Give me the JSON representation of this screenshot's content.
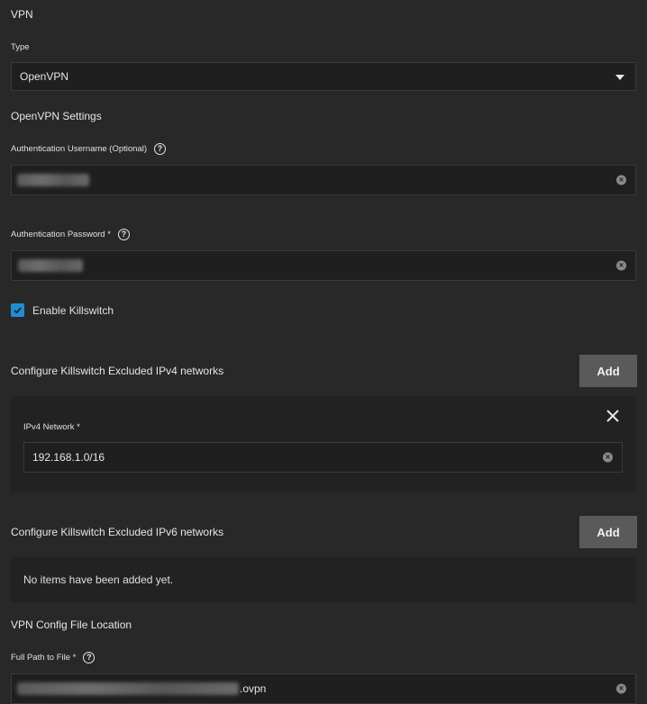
{
  "vpn": {
    "section_title": "VPN",
    "type_label": "Type",
    "type_value": "OpenVPN"
  },
  "openvpn": {
    "section_title": "OpenVPN Settings",
    "username_label": "Authentication Username (Optional)",
    "password_label": "Authentication Password *",
    "killswitch_label": "Enable Killswitch",
    "killswitch_checked": true
  },
  "ipv4": {
    "title": "Configure Killswitch Excluded IPv4 networks",
    "add_label": "Add",
    "network_label": "IPv4 Network *",
    "network_value": "192.168.1.0/16"
  },
  "ipv6": {
    "title": "Configure Killswitch Excluded IPv6 networks",
    "add_label": "Add",
    "empty_text": "No items have been added yet."
  },
  "config": {
    "section_title": "VPN Config File Location",
    "path_label": "Full Path to File *",
    "path_suffix": ".ovpn"
  },
  "icons": {
    "help": "help-circle-icon",
    "clear": "clear-circle-icon",
    "dropdown": "triangle-down-icon",
    "close": "close-icon",
    "check": "checkmark-icon"
  },
  "colors": {
    "background": "#282828",
    "field": "#1f1f1f",
    "checkbox": "#1f8dd6",
    "button": "#5a5a5a"
  }
}
